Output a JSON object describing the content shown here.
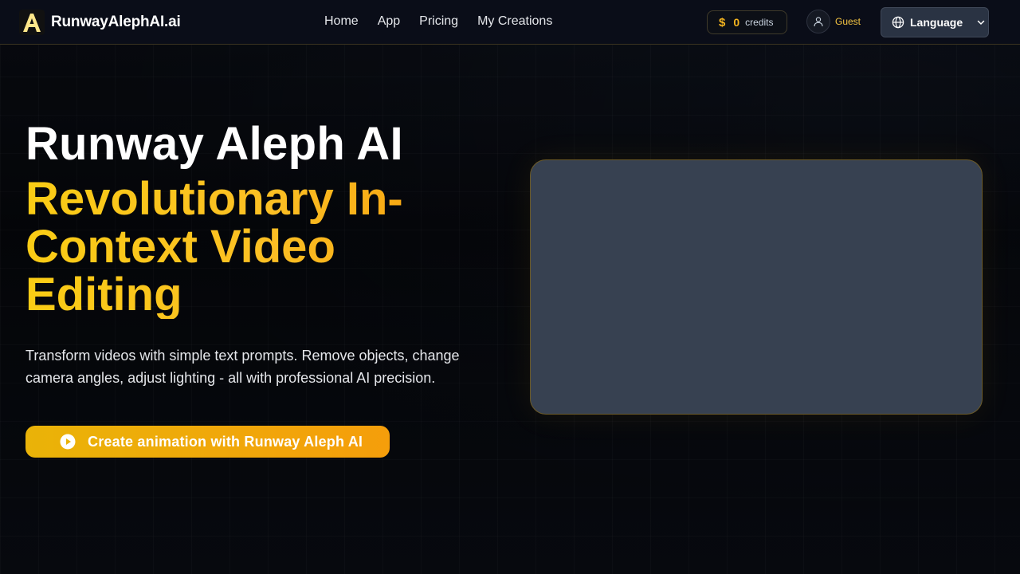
{
  "navbar": {
    "brand": {
      "logo_letter": "A",
      "name": "RunwayAlephAI.ai"
    },
    "links": [
      {
        "label": "Home"
      },
      {
        "label": "App"
      },
      {
        "label": "Pricing"
      },
      {
        "label": "My Creations"
      }
    ],
    "credits": {
      "icon": "dollar-icon",
      "amount": "0",
      "label": "credits"
    },
    "user": {
      "icon": "user-icon",
      "label": "Guest"
    },
    "language": {
      "icon": "globe-icon",
      "label": "Language",
      "chevron": "chevron-down-icon"
    }
  },
  "hero": {
    "title": "Runway Aleph AI",
    "subtitle": "Revolutionary In-Context Video Editing",
    "description": "Transform videos with simple text prompts. Remove objects, change camera angles, adjust lighting - all with professional AI precision.",
    "cta": {
      "icon": "play-circle-icon",
      "label": "Create animation with Runway Aleph AI"
    }
  },
  "colors": {
    "accent": "#f5b51f",
    "gradient_start": "#facc15",
    "gradient_end": "#f59e0b",
    "panel": "#374151",
    "nav_bg": "#0a0d18"
  }
}
